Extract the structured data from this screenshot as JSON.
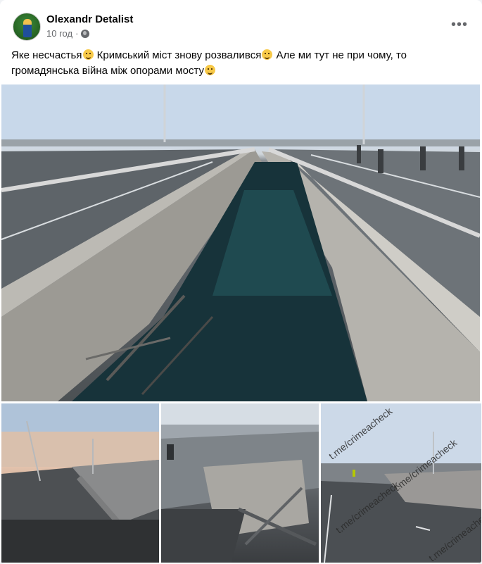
{
  "post": {
    "author": "Olexandr Detalist",
    "time": "10 год",
    "privacy_icon": "globe-icon",
    "more_icon": "more-options-icon",
    "text_part1": "Яке несчастья",
    "text_part2": " Кримський міст знову розвалився",
    "text_part3": " Але ми тут не при чому, то громадянська війна між опорами мосту",
    "more_label": "•••"
  },
  "photos": {
    "main_alt": "damaged bridge photo",
    "thumb3_watermark": "t.me/crimeacheck"
  },
  "colors": {
    "text": "#050505",
    "secondary_text": "#65676b",
    "background": "#ffffff"
  }
}
